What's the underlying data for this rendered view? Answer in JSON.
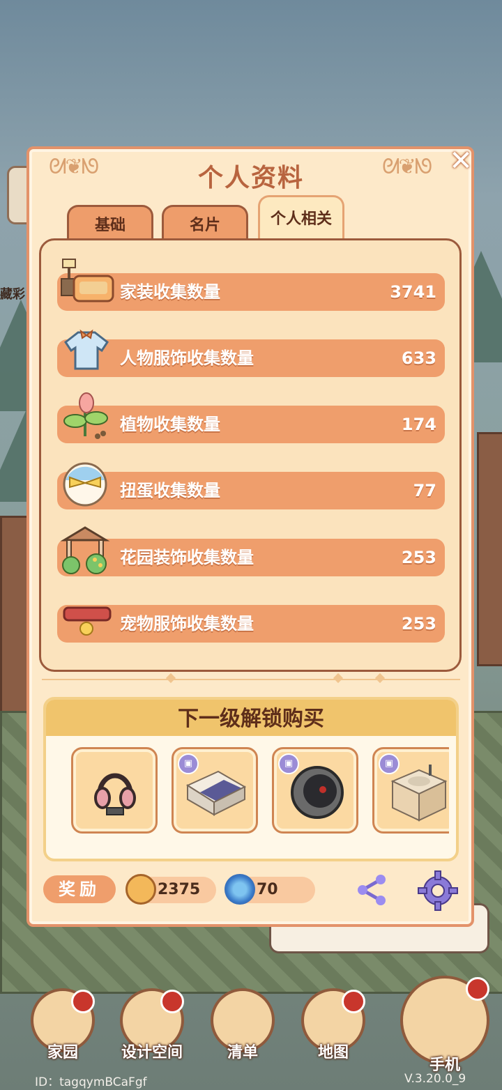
{
  "side_label": "藏彩",
  "panel": {
    "title": "个人资料",
    "close_symbol": "✕",
    "tabs": [
      {
        "label": "基础",
        "active": false
      },
      {
        "label": "名片",
        "active": false
      },
      {
        "label": "个人相关",
        "active": true
      }
    ]
  },
  "stats": [
    {
      "label": "家装收集数量",
      "value": "3741",
      "icon": "sofa-lamp-icon"
    },
    {
      "label": "人物服饰收集数量",
      "value": "633",
      "icon": "shirt-icon"
    },
    {
      "label": "植物收集数量",
      "value": "174",
      "icon": "sprout-icon"
    },
    {
      "label": "扭蛋收集数量",
      "value": "77",
      "icon": "gacha-egg-icon"
    },
    {
      "label": "花园装饰收集数量",
      "value": "253",
      "icon": "gazebo-icon"
    },
    {
      "label": "宠物服饰收集数量",
      "value": "253",
      "icon": "pet-collar-icon"
    }
  ],
  "unlock": {
    "title": "下一级解锁购买",
    "items": [
      "headphones-icon",
      "bed-icon",
      "egg-chair-icon",
      "sink-icon"
    ]
  },
  "footer": {
    "reward_label": "奖励",
    "coins": "2375",
    "gems": "70"
  },
  "nav": [
    {
      "label": "家园"
    },
    {
      "label": "设计空间"
    },
    {
      "label": "清单"
    },
    {
      "label": "地图"
    },
    {
      "label": "手机"
    }
  ],
  "id_text": "ID：tagqymBCaFgf",
  "version": "V.3.20.0_9"
}
